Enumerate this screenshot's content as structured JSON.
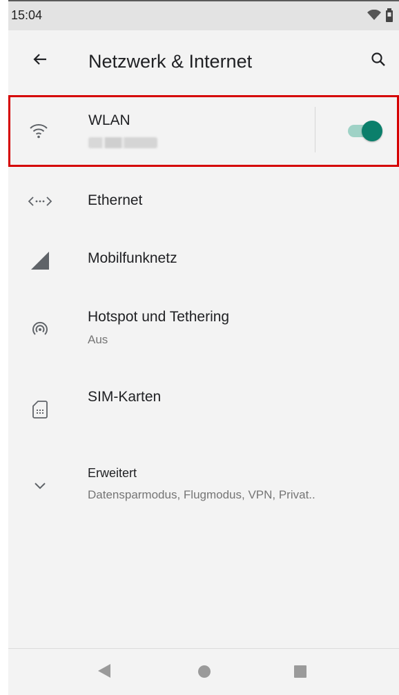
{
  "status_bar": {
    "time": "15:04",
    "wifi_icon": "wifi-icon",
    "battery_icon": "battery-icon"
  },
  "app_bar": {
    "title": "Netzwerk & Internet",
    "back_icon": "arrow-back-icon",
    "search_icon": "search-icon"
  },
  "wlan": {
    "title": "WLAN",
    "network_name_blurred": true,
    "toggle_on": true,
    "accent": "#0b7f6b",
    "highlight": "#d50000"
  },
  "items": [
    {
      "title": "Ethernet",
      "subtitle": "",
      "icon": "ethernet-icon"
    },
    {
      "title": "Mobilfunknetz",
      "subtitle": "",
      "icon": "cellular-signal-icon"
    },
    {
      "title": "Hotspot und Tethering",
      "subtitle": "Aus",
      "icon": "hotspot-icon"
    },
    {
      "title": "SIM-Karten",
      "subtitle": "",
      "icon": "sim-card-icon"
    },
    {
      "title": "Erweitert",
      "subtitle": "Datensparmodus, Flugmodus, VPN, Privat..",
      "icon": "chevron-down-icon"
    }
  ],
  "nav_bar": {
    "back_icon": "nav-back-icon",
    "home_icon": "nav-home-icon",
    "recents_icon": "nav-recents-icon"
  }
}
